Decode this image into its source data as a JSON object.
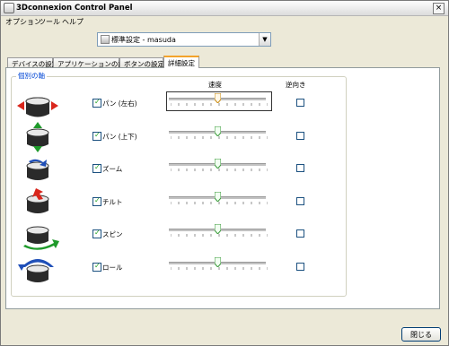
{
  "window": {
    "title": "3Dconnexion Control Panel"
  },
  "menu": [
    "オプション",
    "ツール",
    "ヘルプ"
  ],
  "profile": {
    "selected": "標準設定 - masuda"
  },
  "tabs": [
    "デバイスの設定",
    "アプリケーションの設定",
    "ボタンの設定",
    "詳細設定"
  ],
  "active_tab": 3,
  "group": {
    "label": "個別の軸",
    "speed_header": "速度",
    "reverse_header": "逆向き"
  },
  "axes": [
    {
      "label": "パン (左右)",
      "enabled": true,
      "speed": 0.5,
      "reverse": false,
      "icon": "pan-left-right-icon"
    },
    {
      "label": "パン (上下)",
      "enabled": true,
      "speed": 0.5,
      "reverse": false,
      "icon": "pan-up-down-icon"
    },
    {
      "label": "ズーム",
      "enabled": true,
      "speed": 0.5,
      "reverse": false,
      "icon": "zoom-icon"
    },
    {
      "label": "チルト",
      "enabled": true,
      "speed": 0.5,
      "reverse": false,
      "icon": "tilt-icon"
    },
    {
      "label": "スピン",
      "enabled": true,
      "speed": 0.5,
      "reverse": false,
      "icon": "spin-icon"
    },
    {
      "label": "ロール",
      "enabled": true,
      "speed": 0.5,
      "reverse": false,
      "icon": "roll-icon"
    }
  ],
  "close_button": "閉じる",
  "colors": {
    "accent_tab": "#f3a32a",
    "thumb_green": "#5cb85c",
    "thumb_focus": "#e0a020",
    "arrow_red": "#d9261c",
    "arrow_green": "#1e9a2a",
    "arrow_blue": "#1f4fb8"
  }
}
